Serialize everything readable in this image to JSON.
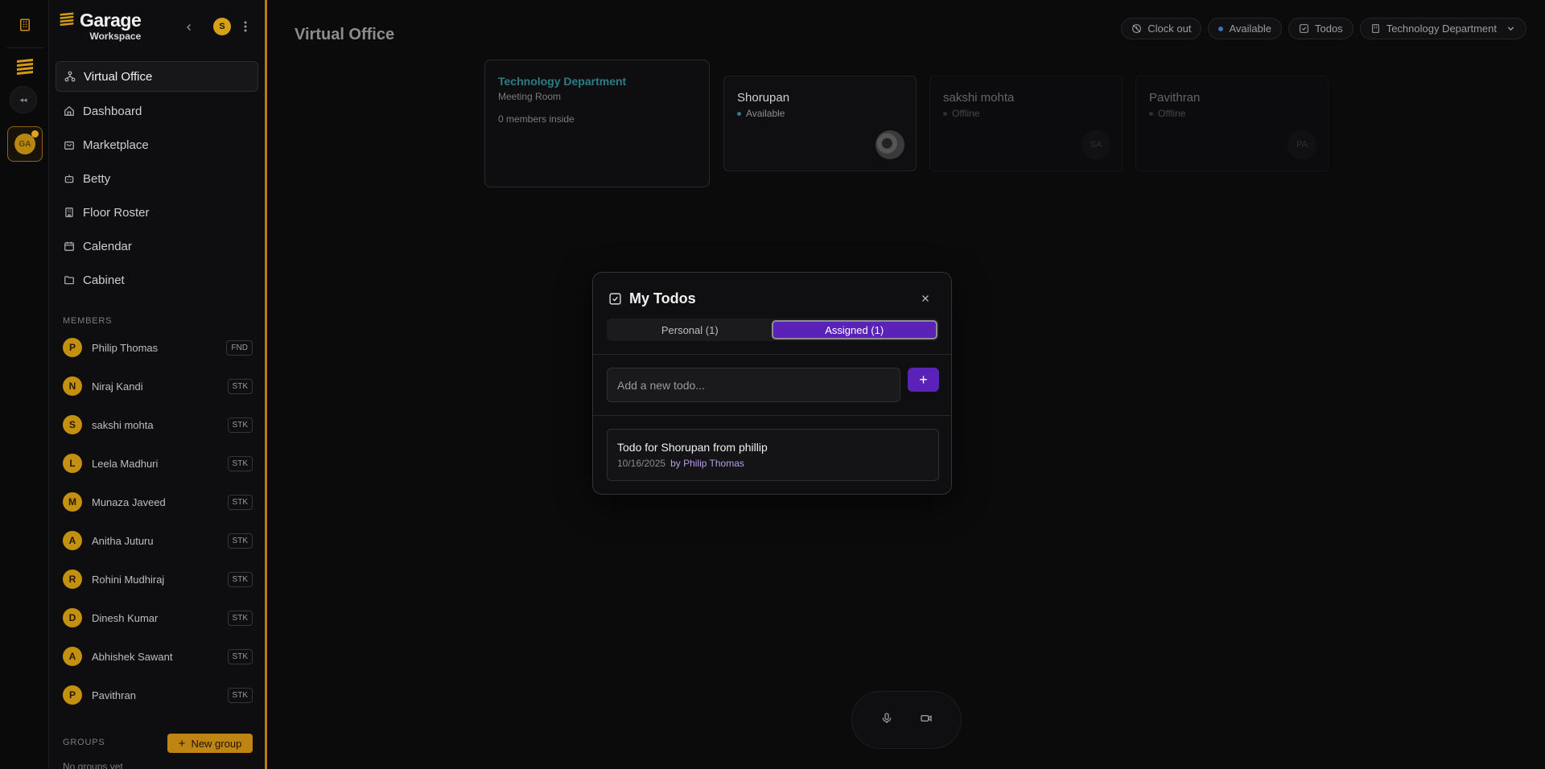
{
  "rail": {
    "items": [
      {
        "name": "building-icon"
      },
      {
        "name": "garage-logo-icon"
      },
      {
        "name": "voice-indicator-icon"
      },
      {
        "name": "workspace-avatar",
        "label": "GA"
      }
    ]
  },
  "sidebar": {
    "brand": {
      "name": "Garage",
      "sub": "Workspace"
    },
    "user_initial": "S",
    "nav": [
      {
        "label": "Virtual Office",
        "icon": "network-icon",
        "active": true
      },
      {
        "label": "Dashboard",
        "icon": "home-icon"
      },
      {
        "label": "Marketplace",
        "icon": "shopping-bag-icon"
      },
      {
        "label": "Betty",
        "icon": "bot-icon"
      },
      {
        "label": "Floor Roster",
        "icon": "building-icon"
      },
      {
        "label": "Calendar",
        "icon": "calendar-icon"
      },
      {
        "label": "Cabinet",
        "icon": "folder-icon"
      }
    ],
    "members_label": "MEMBERS",
    "members": [
      {
        "initial": "P",
        "name": "Philip Thomas",
        "tag": "FND"
      },
      {
        "initial": "N",
        "name": "Niraj Kandi",
        "tag": "STK"
      },
      {
        "initial": "S",
        "name": "sakshi mohta",
        "tag": "STK"
      },
      {
        "initial": "L",
        "name": "Leela Madhuri",
        "tag": "STK"
      },
      {
        "initial": "M",
        "name": "Munaza Javeed",
        "tag": "STK"
      },
      {
        "initial": "A",
        "name": "Anitha Juturu",
        "tag": "STK"
      },
      {
        "initial": "R",
        "name": "Rohini Mudhiraj",
        "tag": "STK"
      },
      {
        "initial": "D",
        "name": "Dinesh Kumar",
        "tag": "STK"
      },
      {
        "initial": "A",
        "name": "Abhishek Sawant",
        "tag": "STK"
      },
      {
        "initial": "P",
        "name": "Pavithran",
        "tag": "STK"
      }
    ],
    "groups_label": "GROUPS",
    "new_group_label": "New group",
    "no_groups": "No groups yet"
  },
  "main": {
    "title": "Virtual Office",
    "topbar": {
      "clock_out": "Clock out",
      "status": "Available",
      "todos": "Todos",
      "department": "Technology Department"
    },
    "room": {
      "title": "Technology Department",
      "subtitle": "Meeting Room",
      "count": "0 members inside"
    },
    "people": [
      {
        "name": "Shorupan",
        "status": "Available",
        "avatar": "",
        "online": true
      },
      {
        "name": "sakshi mohta",
        "status": "Offline",
        "avatar": "SA",
        "online": false
      },
      {
        "name": "Pavithran",
        "status": "Offline",
        "avatar": "PA",
        "online": false
      }
    ]
  },
  "modal": {
    "title": "My Todos",
    "tabs": [
      {
        "label": "Personal (1)",
        "active": false
      },
      {
        "label": "Assigned (1)",
        "active": true
      }
    ],
    "input_placeholder": "Add a new todo...",
    "add_label": "+",
    "todos": [
      {
        "text": "Todo for Shorupan from phillip",
        "date": "10/16/2025",
        "by": "by Philip Thomas"
      }
    ]
  },
  "colors": {
    "accent": "#5b22b8",
    "brand_gold": "#c4900f",
    "room_title": "#2a7e87"
  }
}
